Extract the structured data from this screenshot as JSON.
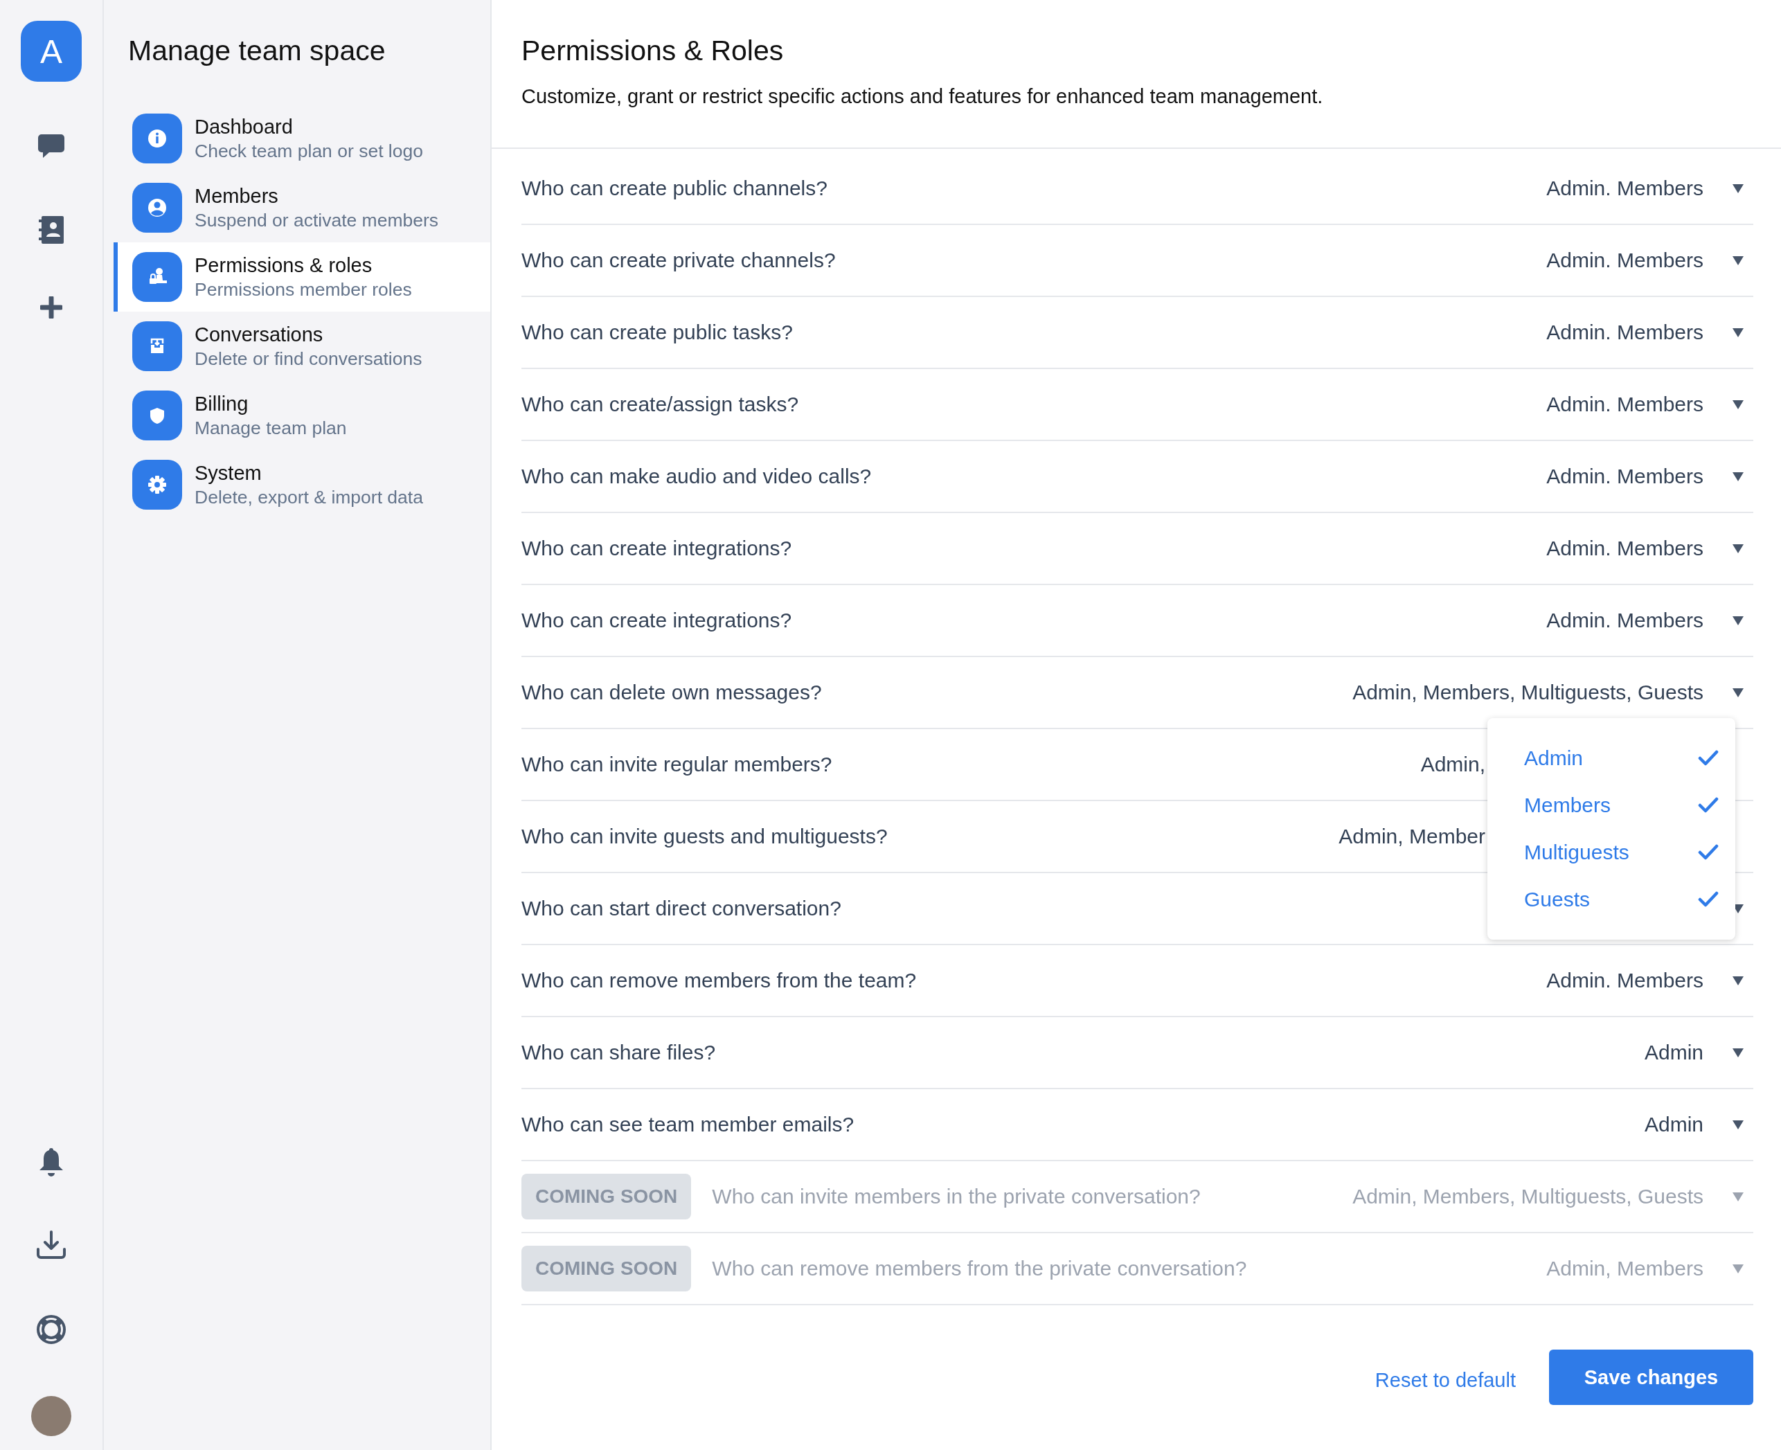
{
  "rail": {
    "logo": "A"
  },
  "sidebar": {
    "title": "Manage team space",
    "items": [
      {
        "title": "Dashboard",
        "subtitle": "Check team plan or set logo",
        "selected": false
      },
      {
        "title": "Members",
        "subtitle": "Suspend or activate members",
        "selected": false
      },
      {
        "title": "Permissions & roles",
        "subtitle": "Permissions member roles",
        "selected": true
      },
      {
        "title": "Conversations",
        "subtitle": "Delete or find conversations",
        "selected": false
      },
      {
        "title": "Billing",
        "subtitle": "Manage team plan",
        "selected": false
      },
      {
        "title": "System",
        "subtitle": "Delete, export & import data",
        "selected": false
      }
    ]
  },
  "main": {
    "title": "Permissions & Roles",
    "description": "Customize, grant or restrict specific actions and features for enhanced team management.",
    "rows": [
      {
        "question": "Who can create public channels?",
        "value": "Admin. Members",
        "disabled": false,
        "covered": false
      },
      {
        "question": "Who can create private channels?",
        "value": "Admin. Members",
        "disabled": false,
        "covered": false
      },
      {
        "question": "Who can create public tasks?",
        "value": "Admin. Members",
        "disabled": false,
        "covered": false
      },
      {
        "question": "Who can create/assign tasks?",
        "value": "Admin. Members",
        "disabled": false,
        "covered": false
      },
      {
        "question": "Who can make audio and video calls?",
        "value": "Admin. Members",
        "disabled": false,
        "covered": false
      },
      {
        "question": "Who can create integrations?",
        "value": "Admin. Members",
        "disabled": false,
        "covered": false
      },
      {
        "question": "Who can create integrations?",
        "value": "Admin. Members",
        "disabled": false,
        "covered": false
      },
      {
        "question": "Who can delete own messages?",
        "value": "Admin, Members, Multiguests, Guests",
        "disabled": false,
        "covered": false,
        "options": [
          {
            "label": "Admin",
            "checked": true
          },
          {
            "label": "Members",
            "checked": true
          },
          {
            "label": "Multiguests",
            "checked": true
          },
          {
            "label": "Guests",
            "checked": true
          }
        ]
      },
      {
        "question": "Who can invite regular members?",
        "value": "Admin,",
        "disabled": false,
        "covered": true
      },
      {
        "question": "Who can invite guests and multiguests?",
        "value": "Admin, Member",
        "disabled": false,
        "covered": true
      },
      {
        "question": "Who can start direct conversation?",
        "disabled": false
      },
      {
        "question": "Who can remove members from the team?",
        "value": "Admin. Members",
        "disabled": false,
        "covered": false
      },
      {
        "question": "Who can share files?",
        "value": "Admin",
        "disabled": false,
        "covered": false
      },
      {
        "question": "Who can see team member emails?",
        "value": "Admin",
        "disabled": false,
        "covered": false
      },
      {
        "badge": "COMING SOON",
        "question": "Who can invite members in the private conversation?",
        "value": "Admin, Members, Multiguests, Guests",
        "disabled": true,
        "covered": false
      },
      {
        "badge": "COMING SOON",
        "question": "Who can remove members from the private conversation?",
        "value": "Admin, Members",
        "disabled": true,
        "covered": false
      }
    ],
    "reset_link": "Reset to default",
    "save_button": "Save changes"
  }
}
